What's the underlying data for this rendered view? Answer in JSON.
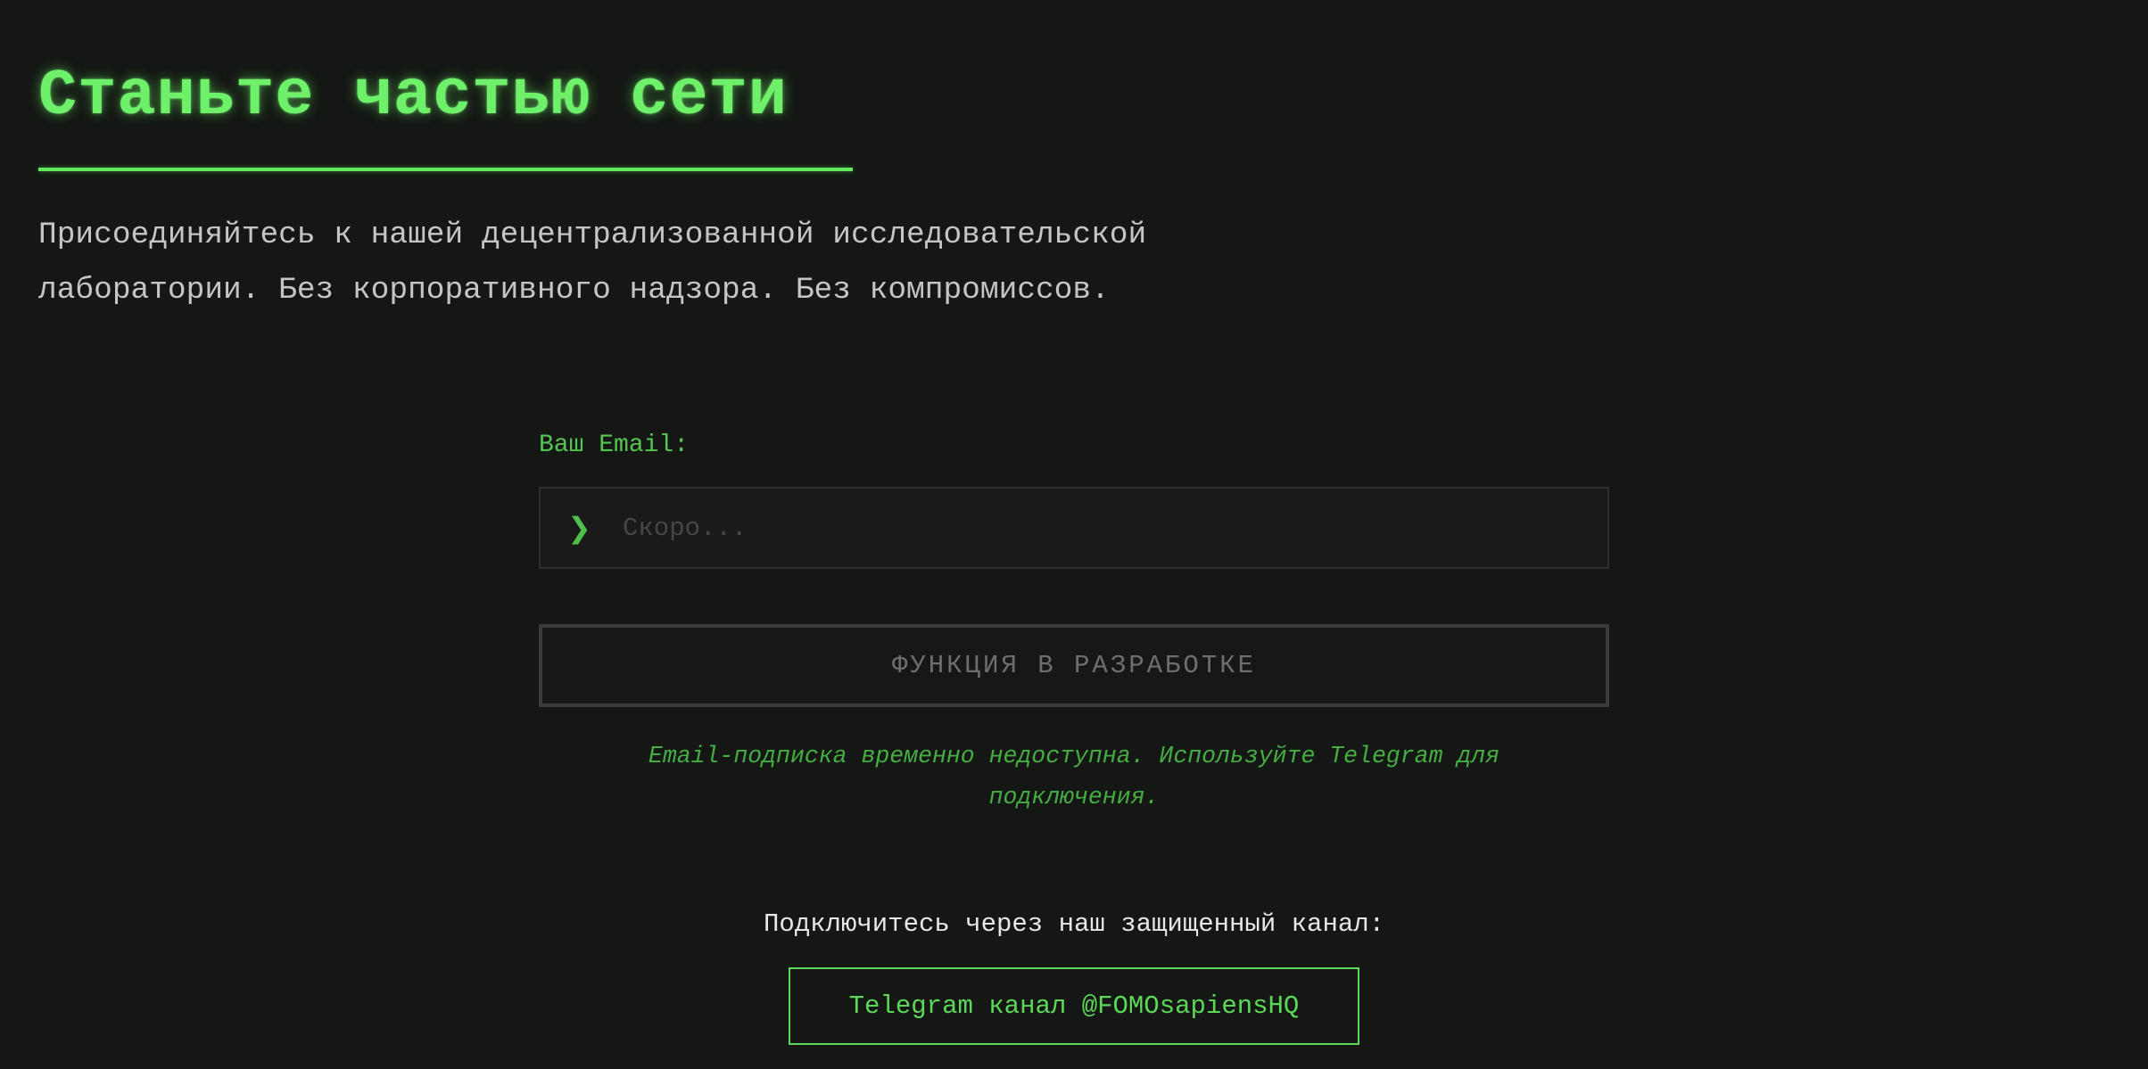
{
  "hero": {
    "title": "Станьте частью сети",
    "description": "Присоединяйтесь к нашей децентрализованной исследовательской лаборатории. Без корпоративного надзора. Без компромиссов."
  },
  "form": {
    "email_label": "Ваш Email:",
    "prompt_icon": "❯",
    "email_placeholder": "Скоро...",
    "email_value": "",
    "submit_label": "ФУНКЦИЯ В РАЗРАБОТКЕ",
    "notice": "Email-подписка временно недоступна. Используйте Telegram для подключения."
  },
  "connect": {
    "text": "Подключитесь через наш защищенный канал:",
    "telegram_label": "Telegram канал @FOMOsapiensHQ"
  },
  "colors": {
    "background": "#141714",
    "accent_green": "#6ff06a",
    "label_green": "#55c552",
    "muted_text": "#c4c6c4",
    "disabled_gray": "#6d6f6d"
  },
  "icons": {
    "prompt": "chevron-right-icon"
  }
}
